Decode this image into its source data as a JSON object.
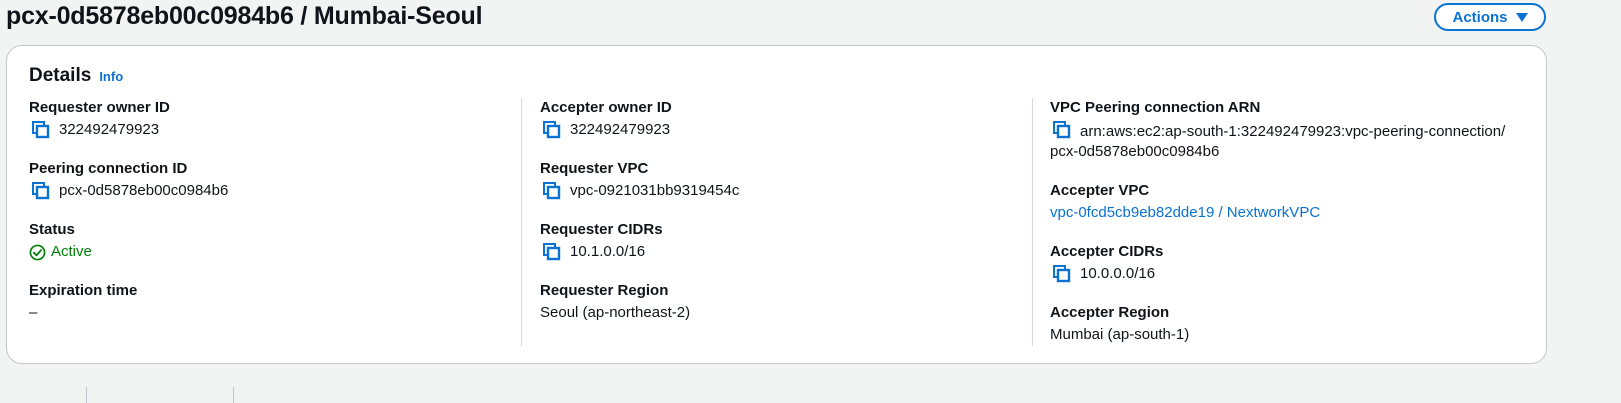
{
  "page": {
    "title": "pcx-0d5878eb00c0984b6 / Mumbai-Seoul",
    "actions_label": "Actions"
  },
  "details": {
    "title": "Details",
    "info_label": "Info",
    "requester_owner_id": {
      "label": "Requester owner ID",
      "value": "322492479923"
    },
    "peering_connection_id": {
      "label": "Peering connection ID",
      "value": "pcx-0d5878eb00c0984b6"
    },
    "status": {
      "label": "Status",
      "value": "Active",
      "color": "#037f0c"
    },
    "expiration_time": {
      "label": "Expiration time",
      "value": "–"
    },
    "accepter_owner_id": {
      "label": "Accepter owner ID",
      "value": "322492479923"
    },
    "requester_vpc": {
      "label": "Requester VPC",
      "value": "vpc-0921031bb9319454c"
    },
    "requester_cidrs": {
      "label": "Requester CIDRs",
      "value": "10.1.0.0/16"
    },
    "requester_region": {
      "label": "Requester Region",
      "value": "Seoul (ap-northeast-2)"
    },
    "vpc_peering_connection_arn": {
      "label": "VPC Peering connection ARN",
      "value": "arn:aws:ec2:ap-south-1:322492479923:vpc-peering-connection/pcx-0d5878eb00c0984b6"
    },
    "accepter_vpc": {
      "label": "Accepter VPC",
      "value": "vpc-0fcd5cb9eb82dde19 / NextworkVPC"
    },
    "accepter_cidrs": {
      "label": "Accepter CIDRs",
      "value": "10.0.0.0/16"
    },
    "accepter_region": {
      "label": "Accepter Region",
      "value": "Mumbai (ap-south-1)"
    }
  },
  "colors": {
    "accent": "#0972d3",
    "success": "#037f0c"
  },
  "icons": [
    "copy-icon",
    "status-success-icon",
    "caret-down-icon"
  ]
}
